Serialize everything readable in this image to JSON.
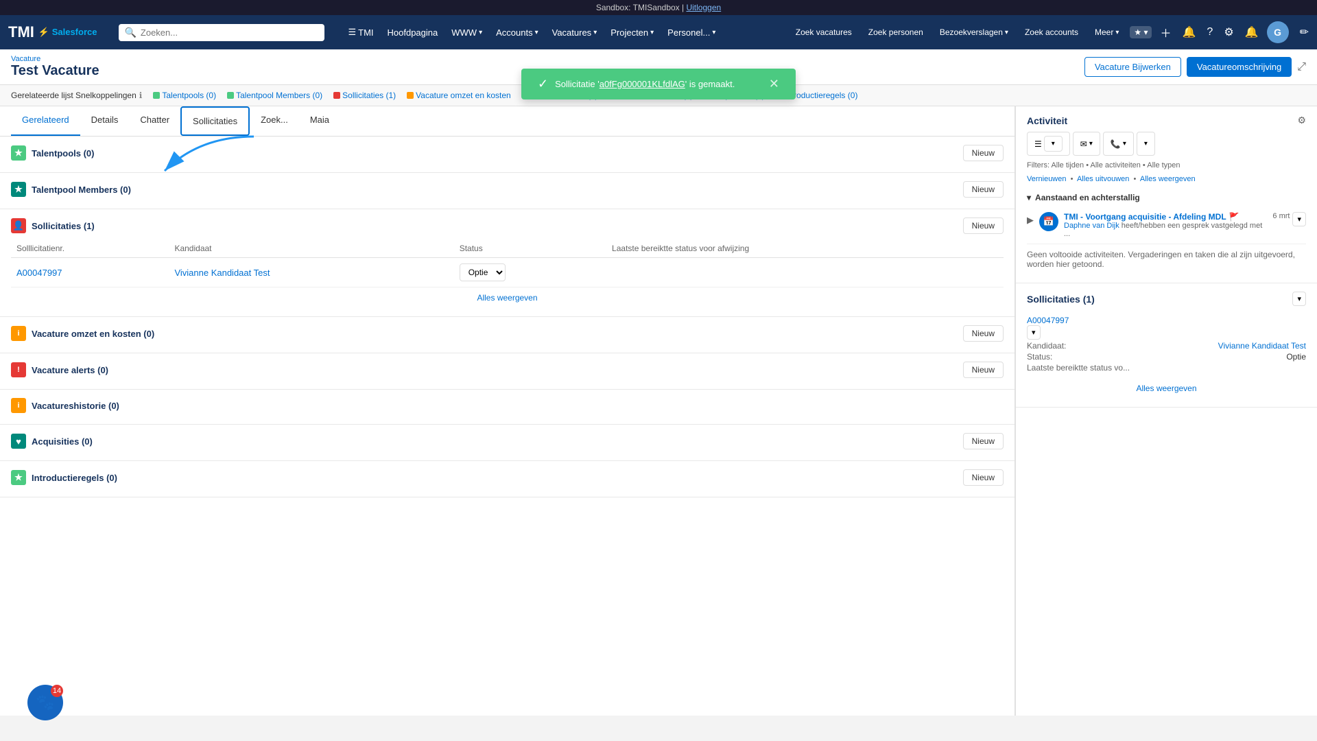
{
  "topbar": {
    "sandbox_text": "Sandbox: TMISandbox | ",
    "logout_link": "Uitloggen"
  },
  "navbar": {
    "tmi_label": "TMI",
    "salesforce_label": "Salesforce",
    "search_placeholder": "Zoeken...",
    "items": [
      {
        "label": "TMI",
        "has_chevron": false
      },
      {
        "label": "Hoofdpagina",
        "has_chevron": false
      },
      {
        "label": "WWW",
        "has_chevron": true
      },
      {
        "label": "Accounts",
        "has_chevron": true
      },
      {
        "label": "Vacatures",
        "has_chevron": true
      },
      {
        "label": "Projecten",
        "has_chevron": true
      },
      {
        "label": "Personel...",
        "has_chevron": true
      }
    ],
    "right_items": [
      {
        "label": "Zoek vacatures"
      },
      {
        "label": "Zoek personen"
      },
      {
        "label": "Bezoekverslagen",
        "has_chevron": true
      },
      {
        "label": "Zoek accounts"
      },
      {
        "label": "Meer",
        "has_chevron": true
      }
    ],
    "avatar_initials": "G"
  },
  "toast": {
    "message": "Sollicitatie 'a0fFg000001KLfdlAG' is gemaakt.",
    "link_text": "a0fFg000001KLfdlAG"
  },
  "page": {
    "breadcrumb": "Vacature",
    "title": "Test Vacature",
    "btn_bijwerken": "Vacature Bijwerken",
    "btn_omschrijving": "Vacatureomschrijving"
  },
  "quick_links": {
    "title": "Gerelateerde lijst Snelkoppelingen",
    "links": [
      {
        "label": "Talentpools (0)",
        "color": "green"
      },
      {
        "label": "Talentpool Members (0)",
        "color": "green"
      },
      {
        "label": "Sollicitaties (1)",
        "color": "red"
      },
      {
        "label": "Vacature omzet en kosten",
        "color": "orange"
      },
      {
        "label": "Vacature alerts (0)",
        "color": "red"
      },
      {
        "label": "Vacatureshistorie (0)",
        "color": "red"
      },
      {
        "label": "Acquisities (0)",
        "color": "teal"
      },
      {
        "label": "Introductieregels (0)",
        "color": "green"
      }
    ]
  },
  "tabs": [
    {
      "label": "Gerelateerd",
      "active": true,
      "highlighted": false
    },
    {
      "label": "Details",
      "active": false,
      "highlighted": false
    },
    {
      "label": "Chatter",
      "active": false,
      "highlighted": false
    },
    {
      "label": "Sollicitaties",
      "active": false,
      "highlighted": true
    },
    {
      "label": "Zoek...",
      "active": false,
      "highlighted": false
    },
    {
      "label": "Maia",
      "active": false,
      "highlighted": false
    }
  ],
  "sections": [
    {
      "id": "talentpools",
      "title": "Talentpools (0)",
      "icon_type": "green",
      "icon": "★",
      "has_new": true,
      "new_label": "Nieuw"
    },
    {
      "id": "talentpool_members",
      "title": "Talentpool Members (0)",
      "icon_type": "teal",
      "icon": "★",
      "has_new": true,
      "new_label": "Nieuw"
    },
    {
      "id": "sollicitaties",
      "title": "Sollicitaties (1)",
      "icon_type": "red",
      "icon": "👤",
      "has_new": true,
      "new_label": "Nieuw",
      "has_table": true,
      "table": {
        "columns": [
          "Solllicitatienr.",
          "Kandidaat",
          "Status",
          "Laatst bereiktte status voor afwijzing"
        ],
        "rows": [
          {
            "nr": "A00047997",
            "kandidaat": "Vivianne Kandidaat Test",
            "status": "Optie"
          }
        ],
        "alles_label": "Alles weergeven"
      }
    },
    {
      "id": "vacature_omzet",
      "title": "Vacature omzet en kosten (0)",
      "icon_type": "orange",
      "icon": "i",
      "has_new": true,
      "new_label": "Nieuw"
    },
    {
      "id": "vacature_alerts",
      "title": "Vacature alerts (0)",
      "icon_type": "red",
      "icon": "!",
      "has_new": true,
      "new_label": "Nieuw"
    },
    {
      "id": "vacatureshistorie",
      "title": "Vacatureshistorie (0)",
      "icon_type": "orange",
      "icon": "i",
      "has_new": false
    },
    {
      "id": "acquisities",
      "title": "Acquisities (0)",
      "icon_type": "teal",
      "icon": "♥",
      "has_new": true,
      "new_label": "Nieuw"
    },
    {
      "id": "introductieregels",
      "title": "Introductieregels (0)",
      "icon_type": "green",
      "icon": "★",
      "has_new": true,
      "new_label": "Nieuw"
    }
  ],
  "activity": {
    "title": "Activiteit",
    "filters_label": "Filters: Alle tijden • Alle activiteiten • Alle typen",
    "vernieuwen": "Vernieuwen",
    "alles_uitvouwen": "Alles uitvouwen",
    "alles_weergeven": "Alles weergeven",
    "group": "Aanstaand en achterstallig",
    "item": {
      "title": "TMI - Voortgang acquisitie - Afdeling MDL",
      "date": "6 mrt",
      "description": "heeft/hebben een gesprek vastgelegd met ..."
    },
    "sub_user": "Daphne van Dijk",
    "no_activity": "Geen voltooide activiteiten. Vergaderingen en taken die al zijn uitgevoerd, worden hier getoond."
  },
  "sollicitaties_panel": {
    "title": "Sollicitaties (1)",
    "item": {
      "nr": "A00047997",
      "kandidaat_label": "Kandidaat:",
      "kandidaat_value": "Vivianne Kandidaat Test",
      "status_label": "Status:",
      "status_value": "Optie",
      "laatste_label": "Laatste bereiktte status vo...",
      "alles_label": "Alles weergeven"
    }
  },
  "heart_badge": "14"
}
